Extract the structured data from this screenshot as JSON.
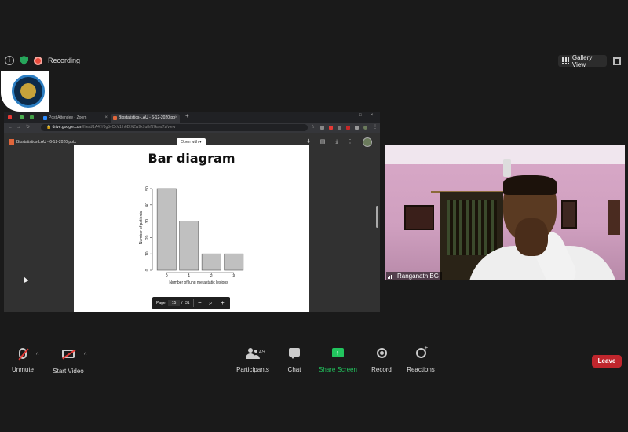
{
  "top_bar": {
    "recording_label": "Recording",
    "gallery_view_label": "Gallery View"
  },
  "browser": {
    "tabs": [
      {
        "label": "Post Attendee - Zoom",
        "fav_color": "#2d8cff"
      },
      {
        "label": "Biostatistics-LAU - 6-12-2020.pp",
        "fav_color": "#e0663b"
      }
    ],
    "address_domain": "drive.google.com",
    "address_path": "/file/d/1A4tY0g5vCkV1 h6DlXZw9k7uthN7kaw7z/view",
    "file_title": "Biostatistics-LAU - 6-12-2020.pptx",
    "open_with_label": "Open with"
  },
  "slide": {
    "title": "Bar diagram"
  },
  "chart_data": {
    "type": "bar",
    "categories": [
      "0",
      "1",
      "2",
      "3"
    ],
    "values": [
      50,
      30,
      10,
      10
    ],
    "xlabel": "Number of lung metastatic lesions",
    "ylabel": "Number of patients",
    "ylim": [
      0,
      50
    ],
    "yticks": [
      0,
      10,
      20,
      30,
      40,
      50
    ],
    "bar_color": "#c0c0c0",
    "grid": false
  },
  "pager": {
    "page_label": "Page",
    "current_page": "15",
    "separator": "/",
    "total_pages": "31"
  },
  "video": {
    "participant_name": "Ranganath BG"
  },
  "toolbar": {
    "unmute_label": "Unmute",
    "start_video_label": "Start Video",
    "participants_label": "Participants",
    "participants_count": "49",
    "chat_label": "Chat",
    "share_screen_label": "Share Screen",
    "record_label": "Record",
    "reactions_label": "Reactions",
    "leave_label": "Leave"
  },
  "colors": {
    "share_green": "#22c55e",
    "leave_red": "#c0262d",
    "recording_red": "#e94b3c"
  }
}
